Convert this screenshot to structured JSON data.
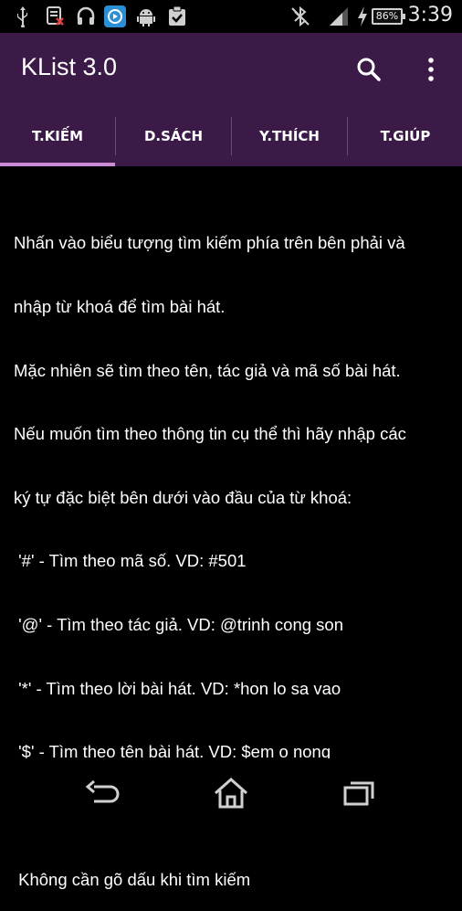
{
  "status_bar": {
    "time": "3:39",
    "battery_percent": "86%",
    "icons": [
      "usb-icon",
      "sim-data-icon",
      "headset-icon",
      "media-app-icon",
      "android-icon",
      "clipboard-check-icon",
      "bluetooth-off-icon",
      "signal-icon",
      "charging-icon",
      "battery-icon"
    ]
  },
  "app_bar": {
    "title": "KList 3.0",
    "icons": [
      "search-icon",
      "overflow-menu-icon"
    ]
  },
  "tabs": [
    {
      "label": "T.KIẾM",
      "selected": true
    },
    {
      "label": "D.SÁCH",
      "selected": false
    },
    {
      "label": "Y.THÍCH",
      "selected": false
    },
    {
      "label": "T.GIÚP",
      "selected": false
    }
  ],
  "content": {
    "lines": [
      "Nhấn vào biểu tượng tìm kiếm phía trên bên phải và",
      "nhập từ khoá để tìm bài hát.",
      "Mặc nhiên sẽ tìm theo tên, tác giả và mã số bài hát.",
      "Nếu muốn tìm theo thông tin cụ thể thì hãy nhập các",
      "ký tự đặc biệt bên dưới vào đầu của từ khoá:",
      " '#' - Tìm theo mã số. VD: #501",
      " '@' - Tìm theo tác giả. VD: @trinh cong son",
      " '*' - Tìm theo lời bài hát. VD: *hon lo sa vao",
      " '$' - Tìm theo tên bài hát. VD: $em o nong",
      "",
      " Không cần gõ dấu khi tìm kiếm"
    ]
  },
  "nav_bar": {
    "icons": [
      "back-icon",
      "home-icon",
      "recents-icon"
    ]
  },
  "colors": {
    "app_bar": "#3c1a48",
    "tab_indicator": "#c98bd6",
    "background": "#000000",
    "text": "#ffffff"
  }
}
